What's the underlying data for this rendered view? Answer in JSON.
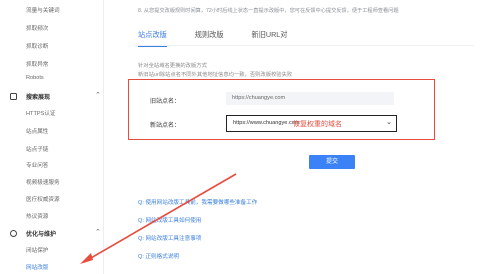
{
  "sidebar": {
    "items_top": [
      "流量与关键词",
      "抓取频次",
      "抓取诊断",
      "抓取异常",
      "Robots"
    ],
    "group1": {
      "label": "搜索展现"
    },
    "items_mid": [
      "HTTPS认证",
      "站点属性",
      "站点子链",
      "专业问答",
      "视频极速服务",
      "医疗权威资源",
      "热议资源"
    ],
    "group2": {
      "label": "优化与维护"
    },
    "items_bottom": [
      "闭站保护",
      "网站改版"
    ]
  },
  "main": {
    "notice": "8. 从您提交改版规则时间算，72小时后线上状态一直提示改版中，您可在反馈中心提交反馈，便于工程师查看问题",
    "tabs": [
      "站点改版",
      "规则改版",
      "新旧URL对"
    ],
    "desc1": "针对全站域名更换的改版方式",
    "desc2": "新旧站url除站点名不同外其他地址信息均一致，否则改版校验失败",
    "old_site_label": "旧站点名：",
    "old_site_value": "https://chuangye.com",
    "new_site_label": "新站点名：",
    "new_site_value": "https://www.chuangye.com",
    "annotation": "恢复权重的域名",
    "submit_label": "提交",
    "faq": [
      "Q: 使用网站改版工具前，我需要做哪些准备工作",
      "Q: 网站改版工具如何使用",
      "Q: 网站改版工具注意事项",
      "Q: 正则格式说明"
    ]
  },
  "colors": {
    "accent": "#3a7fe0",
    "annotation_red": "#e74c3c",
    "button": "#3b82f6"
  }
}
